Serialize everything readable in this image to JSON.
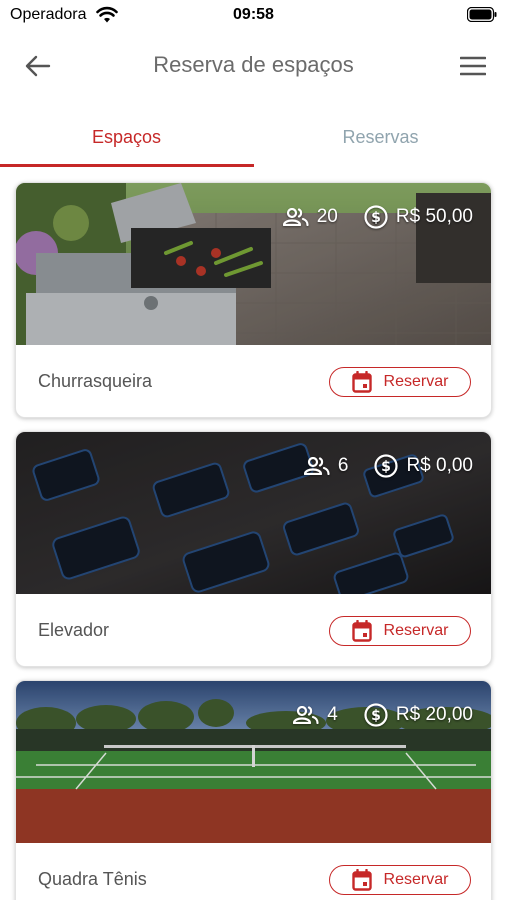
{
  "status_bar": {
    "carrier": "Operadora",
    "time": "09:58"
  },
  "header": {
    "title": "Reserva de espaços",
    "back_icon": "arrow-left-icon",
    "menu_icon": "hamburger-menu-icon"
  },
  "tabs": [
    {
      "label": "Espaços",
      "active": true
    },
    {
      "label": "Reservas",
      "active": false
    }
  ],
  "colors": {
    "accent": "#c62828",
    "inactive_tab": "#90a4ae",
    "title": "#6b6b6b"
  },
  "spaces": [
    {
      "name": "Churrasqueira",
      "capacity": "20",
      "price": "R$ 50,00",
      "button_label": "Reservar",
      "image": "barbecue-grill-photo"
    },
    {
      "name": "Elevador",
      "capacity": "6",
      "price": "R$ 0,00",
      "button_label": "Reservar",
      "image": "elevator-buttons-photo"
    },
    {
      "name": "Quadra Tênis",
      "capacity": "4",
      "price": "R$ 20,00",
      "button_label": "Reservar",
      "image": "tennis-court-photo"
    }
  ]
}
